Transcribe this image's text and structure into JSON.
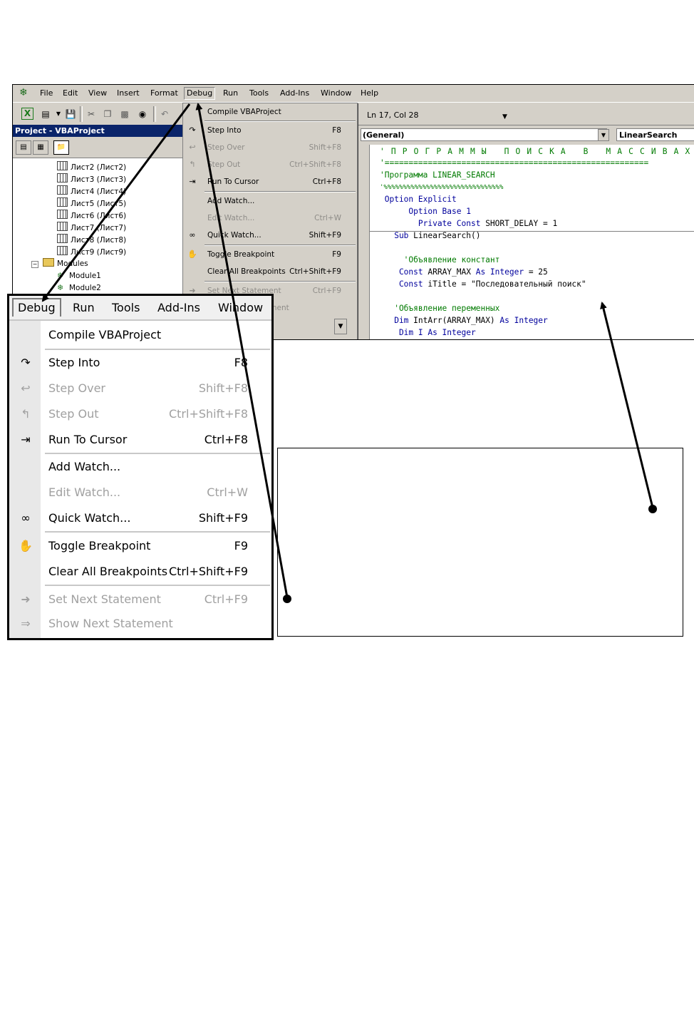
{
  "menubar": {
    "items": [
      "File",
      "Edit",
      "View",
      "Insert",
      "Format",
      "Debug",
      "Run",
      "Tools",
      "Add-Ins",
      "Window",
      "Help"
    ]
  },
  "status": {
    "position": "Ln 17, Col 28"
  },
  "project": {
    "title": "Project - VBAProject",
    "tree": [
      "Лист2 (Лист2)",
      "Лист3 (Лист3)",
      "Лист4 (Лист4)",
      "Лист5 (Лист5)",
      "Лист6 (Лист6)",
      "Лист7 (Лист7)",
      "Лист8 (Лист8)",
      "Лист9 (Лист9)"
    ],
    "modules_label": "Modules",
    "modules": [
      "Module1",
      "Module2"
    ]
  },
  "debug_menu": {
    "items": [
      {
        "label": "Compile VBAProject",
        "shortcut": "",
        "icon": "",
        "enabled": true
      },
      {
        "label": "Step Into",
        "shortcut": "F8",
        "icon": "step-into-icon",
        "enabled": true
      },
      {
        "label": "Step Over",
        "shortcut": "Shift+F8",
        "icon": "step-over-icon",
        "enabled": false
      },
      {
        "label": "Step Out",
        "shortcut": "Ctrl+Shift+F8",
        "icon": "step-out-icon",
        "enabled": false
      },
      {
        "label": "Run To Cursor",
        "shortcut": "Ctrl+F8",
        "icon": "run-to-cursor-icon",
        "enabled": true
      },
      {
        "label": "Add Watch...",
        "shortcut": "",
        "icon": "",
        "enabled": true
      },
      {
        "label": "Edit Watch...",
        "shortcut": "Ctrl+W",
        "icon": "",
        "enabled": false
      },
      {
        "label": "Quick Watch...",
        "shortcut": "Shift+F9",
        "icon": "glasses-icon",
        "enabled": true
      },
      {
        "label": "Toggle Breakpoint",
        "shortcut": "F9",
        "icon": "hand-icon",
        "enabled": true
      },
      {
        "label": "Clear All Breakpoints",
        "shortcut": "Ctrl+Shift+F9",
        "icon": "",
        "enabled": true
      },
      {
        "label": "Set Next Statement",
        "shortcut": "Ctrl+F9",
        "icon": "arrow-right-icon",
        "enabled": false
      },
      {
        "label": "Show Next Statement",
        "shortcut": "",
        "icon": "show-next-icon",
        "enabled": false
      }
    ]
  },
  "code": {
    "object_combo": "(General)",
    "proc_combo": "LinearSearch",
    "lines": [
      {
        "text": "' П Р О Г Р А М М Ы   П О И С К А   В   М А С С И В А Х",
        "cls": "cm"
      },
      {
        "text": "'=======================================================",
        "cls": "cm"
      },
      {
        "text": "'Программа LINEAR_SEARCH",
        "cls": "cm"
      },
      {
        "text": "'%%%%%%%%%%%%%%%%%%%%%%%%%%%%%%%",
        "cls": "cm"
      },
      {
        "text": " Option Explicit",
        "cls": "kw"
      },
      {
        "text": "      Option Base 1",
        "cls": "kw"
      },
      {
        "text": "        Private Const SHORT_DELAY = 1",
        "cls": "mix1"
      },
      {
        "text": "   Sub LinearSearch()",
        "cls": "mix2"
      },
      {
        "text": "",
        "cls": "tx"
      },
      {
        "text": "     'Объявление констант",
        "cls": "cm"
      },
      {
        "text": "    Const ARRAY_MAX As Integer = 25",
        "cls": "mix3"
      },
      {
        "text": "    Const iTitle = \"Последовательный поиск\"",
        "cls": "mix4"
      },
      {
        "text": "",
        "cls": "tx"
      },
      {
        "text": "   'Объявление переменных",
        "cls": "cm"
      },
      {
        "text": "   Dim IntArr(ARRAY_MAX) As Integer",
        "cls": "mix5"
      },
      {
        "text": "    Dim I As Integer",
        "cls": "kw"
      }
    ]
  }
}
